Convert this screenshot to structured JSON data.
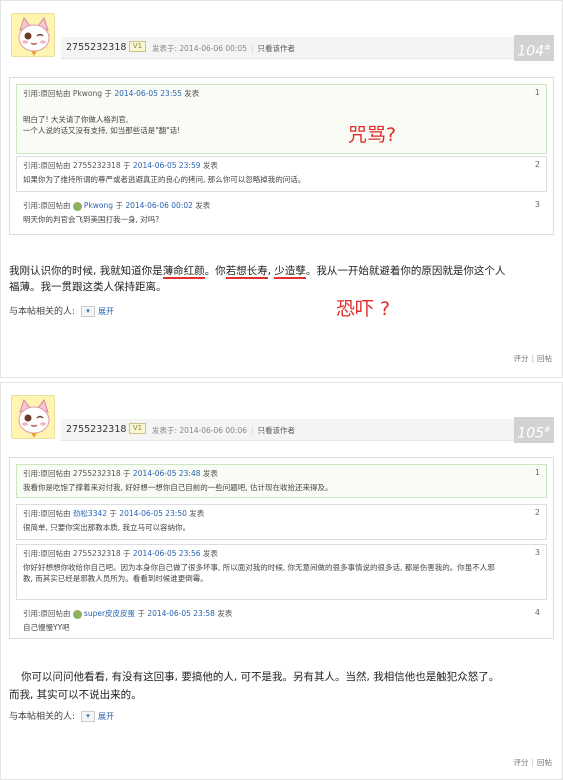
{
  "posts": [
    {
      "username": "2755232318",
      "level": "V1",
      "posted_at": "发表于: 2014-06-06 00:05",
      "only_author": "只看该作者",
      "floor": "104",
      "floor_suffix": "#",
      "quotes": [
        {
          "num": "1",
          "prefix": "引用:原回帖由",
          "user": "Pkwong",
          "mid": "于",
          "time": "2014-06-05 23:55",
          "suffix": "发表",
          "lines": [
            "明白了! 大关请了你做人格判官,",
            "一个人说的话又没有支持, 如当那些话是\"翻\"话!"
          ]
        },
        {
          "num": "2",
          "prefix": "引用:原回帖由",
          "user": "2755232318",
          "mid": "于",
          "time": "2014-06-05 23:59",
          "suffix": "发表",
          "lines": [
            "如果你为了维持所谓的尊严或者逃避真正的良心的拷问, 那么你可以忽略掉我的问话。"
          ]
        },
        {
          "num": "3",
          "prefix": "引用:原回帖由",
          "user": "Pkwong",
          "mid": "于",
          "time": "2014-06-06 00:02",
          "suffix": "发表",
          "lines": [
            "明天你的判官会飞到美国打我一身, 对吗?"
          ]
        }
      ],
      "content_parts": [
        "我刚认识你的时候, 我就知道你是",
        "薄命红颜",
        "。你",
        "若想长寿",
        ", ",
        "少造孽",
        "。我从一开始就避着你的原因就是你这个人",
        "福薄。我一贯跟这类人保持距离。"
      ],
      "related_label": "与本帖相关的人:",
      "expand": "展开",
      "rate": "评分",
      "reply": "回帖"
    },
    {
      "username": "2755232318",
      "level": "V1",
      "posted_at": "发表于: 2014-06-06 00:06",
      "only_author": "只看该作者",
      "floor": "105",
      "floor_suffix": "#",
      "quotes": [
        {
          "num": "1",
          "prefix": "引用:原回帖由",
          "user": "2755232318",
          "mid": "于",
          "time": "2014-06-05 23:48",
          "suffix": "发表",
          "lines": [
            "我看你是吃饱了撑着来对付我, 好好想一想你自己目前的一些问题吧, 估计现在收拾还来得及。"
          ]
        },
        {
          "num": "2",
          "prefix": "引用:原回帖由",
          "user": "劲松3342",
          "mid": "于",
          "time": "2014-06-05 23:50",
          "suffix": "发表",
          "lines": [
            "很简单, 只要你突出那教本质, 我立马可以容纳你。"
          ]
        },
        {
          "num": "3",
          "prefix": "引用:原回帖由",
          "user": "2755232318",
          "mid": "于",
          "time": "2014-06-05 23:56",
          "suffix": "发表",
          "lines": [
            "你好好想想你收给你自己吧。因为本身你自己做了很多坏事, 所以面对我的时候, 你无意间做的很多事情说的很多话, 都是伤害我的。你虽不人邪",
            "教, 而其实已经是邪教人员所为。看看到时候谁更倒霉。"
          ]
        },
        {
          "num": "4",
          "prefix": "引用:原回帖由",
          "user": "super皮皮皮蛋",
          "mid": "于",
          "time": "2014-06-05 23:58",
          "suffix": "发表",
          "lines": [
            "自己慢慢YY吧"
          ]
        }
      ],
      "content_lines": [
        "你可以问问他看看, 有没有这回事, 要搞他的人, 可不是我。另有其人。当然, 我相信他也是触犯众怒了。",
        "而我, 其实可以不说出来的。"
      ],
      "related_label": "与本帖相关的人:",
      "expand": "展开",
      "rate": "评分",
      "reply": "回帖"
    }
  ],
  "annotations": {
    "curse": "咒骂?",
    "threat": "恐吓 ?"
  },
  "colors": {
    "annotation": "#e22a2a",
    "link": "#2a63b0",
    "quote_border": "#cbe6c0",
    "avatar_bg": "#fff4b0"
  }
}
